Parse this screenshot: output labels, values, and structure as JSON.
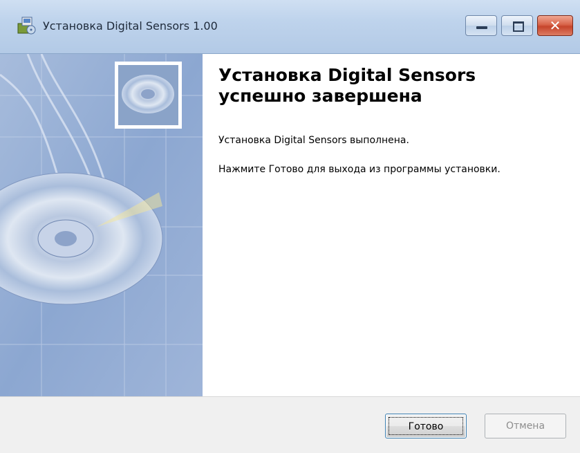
{
  "window": {
    "title": "Установка Digital Sensors 1.00",
    "icon": "installer-icon",
    "controls": {
      "minimize_icon": "minimize-icon",
      "maximize_icon": "maximize-icon",
      "close_icon": "close-icon",
      "close_glyph": "✕"
    }
  },
  "content": {
    "heading": "Установка Digital Sensors успешно завершена",
    "line1": "Установка Digital Sensors выполнена.",
    "line2": "Нажмите Готово для выхода из программы установки."
  },
  "footer": {
    "finish_label": "Готово",
    "cancel_label": "Отмена"
  },
  "colors": {
    "titlebar": "#bed3ec",
    "close_button": "#c6442b",
    "sidebar": "#9db4d6",
    "focus_border": "#3c7fb1"
  }
}
